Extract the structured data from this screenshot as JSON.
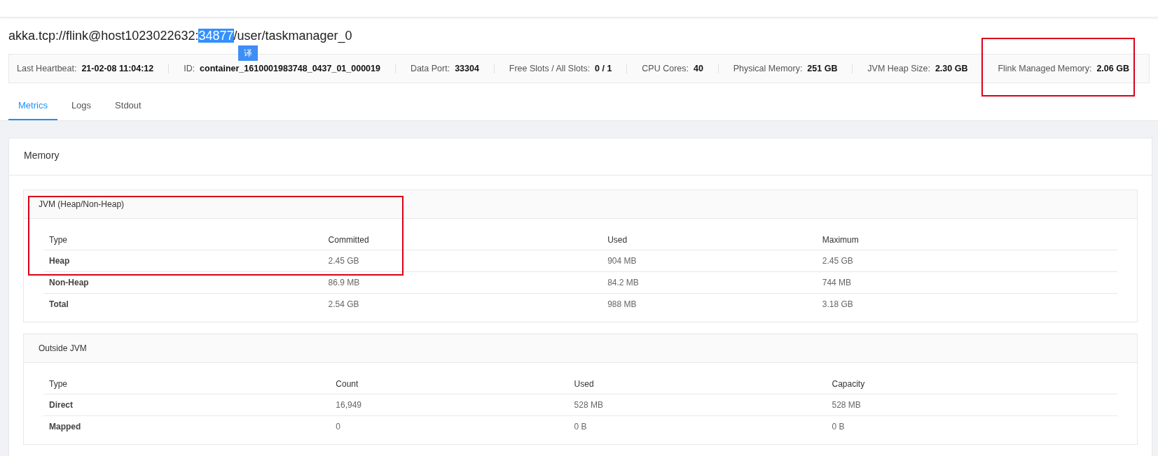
{
  "title": {
    "parts": [
      {
        "text": "akka.tcp://flink@host1023022632:",
        "selected": false
      },
      {
        "text": "34877",
        "selected": true
      },
      {
        "text": "/user/taskmanager_0",
        "selected": false
      }
    ],
    "popup": "译"
  },
  "info": [
    {
      "label": "Last Heartbeat:",
      "value": "21-02-08 11:04:12"
    },
    {
      "label": "ID:",
      "value": "container_1610001983748_0437_01_000019"
    },
    {
      "label": "Data Port:",
      "value": "33304"
    },
    {
      "label": "Free Slots / All Slots:",
      "value": "0 / 1"
    },
    {
      "label": "CPU Cores:",
      "value": "40"
    },
    {
      "label": "Physical Memory:",
      "value": "251 GB"
    },
    {
      "label": "JVM Heap Size:",
      "value": "2.30 GB"
    },
    {
      "label": "Flink Managed Memory:",
      "value": "2.06 GB"
    }
  ],
  "tabs": [
    {
      "label": "Metrics",
      "selected": true
    },
    {
      "label": "Logs",
      "selected": false
    },
    {
      "label": "Stdout",
      "selected": false
    }
  ],
  "card": {
    "title": "Memory",
    "sections": [
      {
        "title": "JVM (Heap/Non-Heap)",
        "columns": [
          "Type",
          "Committed",
          "Used",
          "Maximum"
        ],
        "rows": [
          [
            "Heap",
            "2.45 GB",
            "904 MB",
            "2.45 GB"
          ],
          [
            "Non-Heap",
            "86.9 MB",
            "84.2 MB",
            "744 MB"
          ],
          [
            "Total",
            "2.54 GB",
            "988 MB",
            "3.18 GB"
          ]
        ]
      },
      {
        "title": "Outside JVM",
        "columns": [
          "Type",
          "Count",
          "Used",
          "Capacity"
        ],
        "rows": [
          [
            "Direct",
            "16,949",
            "528 MB",
            "528 MB"
          ],
          [
            "Mapped",
            "0",
            "0 B",
            "0 B"
          ]
        ]
      }
    ]
  }
}
